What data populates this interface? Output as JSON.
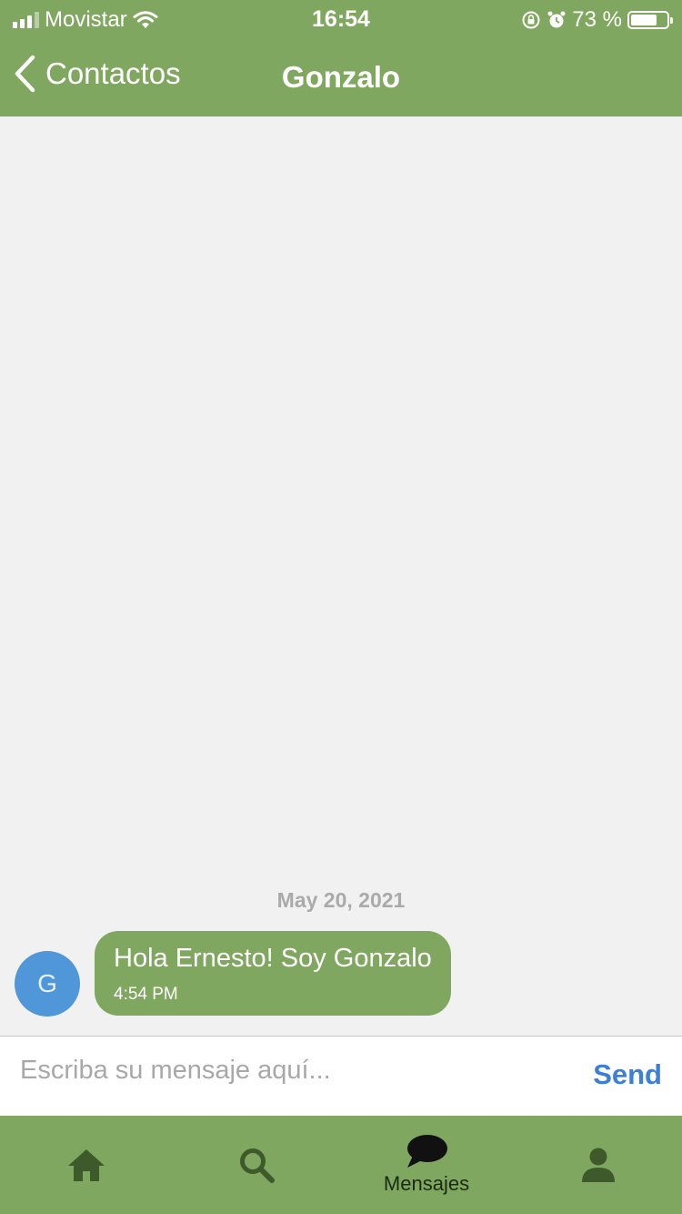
{
  "status_bar": {
    "carrier": "Movistar",
    "time": "16:54",
    "battery_percent": "73 %",
    "battery_level": 0.73
  },
  "nav": {
    "back_label": "Contactos",
    "title": "Gonzalo"
  },
  "chat": {
    "date_separator": "May 20, 2021",
    "messages": [
      {
        "avatar_initial": "G",
        "text": "Hola Ernesto! Soy Gonzalo",
        "time": "4:54 PM"
      }
    ]
  },
  "composer": {
    "placeholder": "Escriba su mensaje aquí...",
    "send_label": "Send"
  },
  "tabbar": {
    "tabs": [
      {
        "icon": "home-icon",
        "label": ""
      },
      {
        "icon": "search-icon",
        "label": ""
      },
      {
        "icon": "chat-bubble-icon",
        "label": "Mensajes",
        "active": true
      },
      {
        "icon": "user-icon",
        "label": ""
      }
    ]
  },
  "colors": {
    "brand_green": "#80a75f",
    "avatar_blue": "#4f97d8",
    "send_blue": "#3c7fd6",
    "tab_icon": "#3e5a2a",
    "tab_icon_active": "#111111"
  }
}
